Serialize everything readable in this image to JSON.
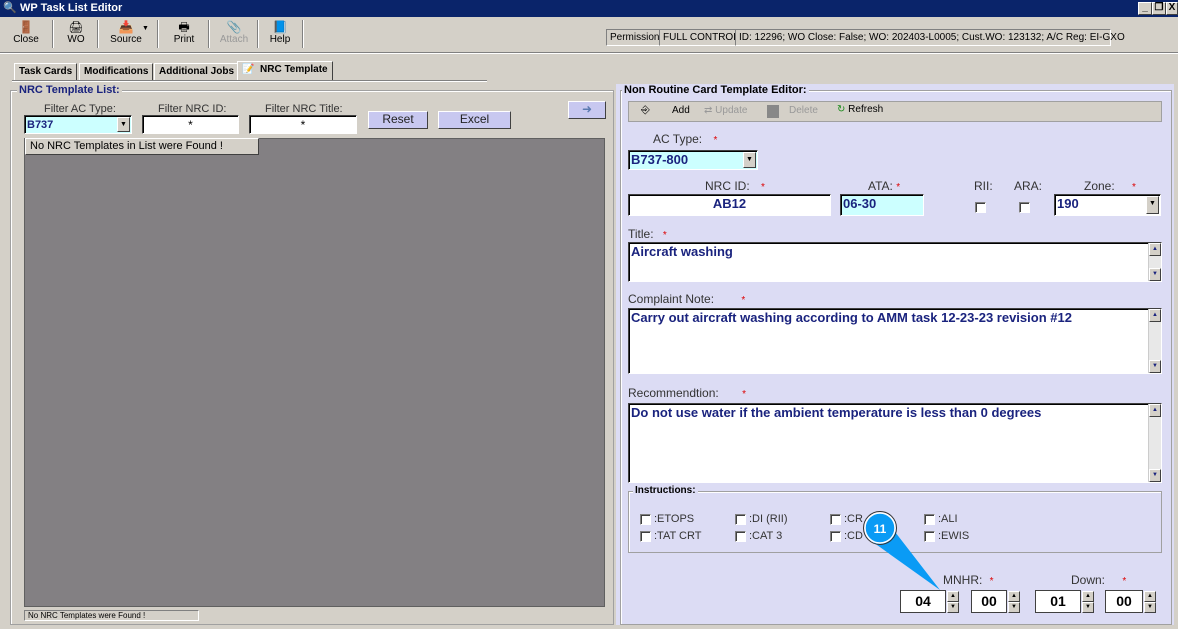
{
  "window": {
    "title": "WP Task List Editor",
    "minimize": "_",
    "restore": "❐",
    "close": "X"
  },
  "toolbar": {
    "close": "Close",
    "wo": "WO",
    "source": "Source",
    "print": "Print",
    "attach": "Attach",
    "help": "Help"
  },
  "status": {
    "permission_label": "Permission:",
    "permission_value": "FULL CONTROL",
    "info": "ID: 12296; WO Close: False; WO: 202403-L0005; Cust.WO: 123132; A/C Reg: EI-GXO"
  },
  "tabs": [
    "Task Cards",
    "Modifications",
    "Additional Jobs",
    "NRC Template"
  ],
  "left": {
    "title": "NRC Template List:",
    "filter_ac_label": "Filter AC Type:",
    "filter_ac_value": "B737",
    "filter_id_label": "Filter NRC ID:",
    "filter_id_value": "*",
    "filter_title_label": "Filter NRC Title:",
    "filter_title_value": "*",
    "reset": "Reset",
    "excel": "Excel",
    "arrow": "➜",
    "grid_message": "No NRC Templates in List were Found !",
    "status": "No NRC Templates were Found !"
  },
  "right": {
    "title": "Non Routine Card Template Editor:",
    "toolbar": {
      "add": "Add",
      "update": "Update",
      "delete": "Delete",
      "refresh": "Refresh"
    },
    "ac_type_label": "AC Type:",
    "ac_type_value": "B737-800",
    "nrc_id_label": "NRC ID:",
    "nrc_id_value": "AB12",
    "ata_label": "ATA:",
    "ata_value": "06-30",
    "rii_label": "RII:",
    "ara_label": "ARA:",
    "zone_label": "Zone:",
    "zone_value": "190",
    "title_label": "Title:",
    "title_value": "Aircraft washing",
    "complaint_label": "Complaint Note:",
    "complaint_value": "Carry out aircraft washing  according to AMM task 12-23-23 revision #12",
    "recommendation_label": "Recommendtion:",
    "recommendation_value": "Do not use water if the ambient temperature is less than 0 degrees",
    "instructions_label": "Instructions:",
    "instructions": [
      ":ETOPS",
      ":DI (RII)",
      ":CR",
      ":ALI",
      ":TAT CRT",
      ":CAT 3",
      ":CD",
      ":EWIS"
    ],
    "mnhr_label": "MNHR:",
    "mnhr_hours": "04",
    "mnhr_minutes": "00",
    "down_label": "Down:",
    "down_hours": "01",
    "down_minutes": "00",
    "required_mark": "*"
  },
  "callout": {
    "number": "11",
    "color": "#0a9bf5"
  }
}
